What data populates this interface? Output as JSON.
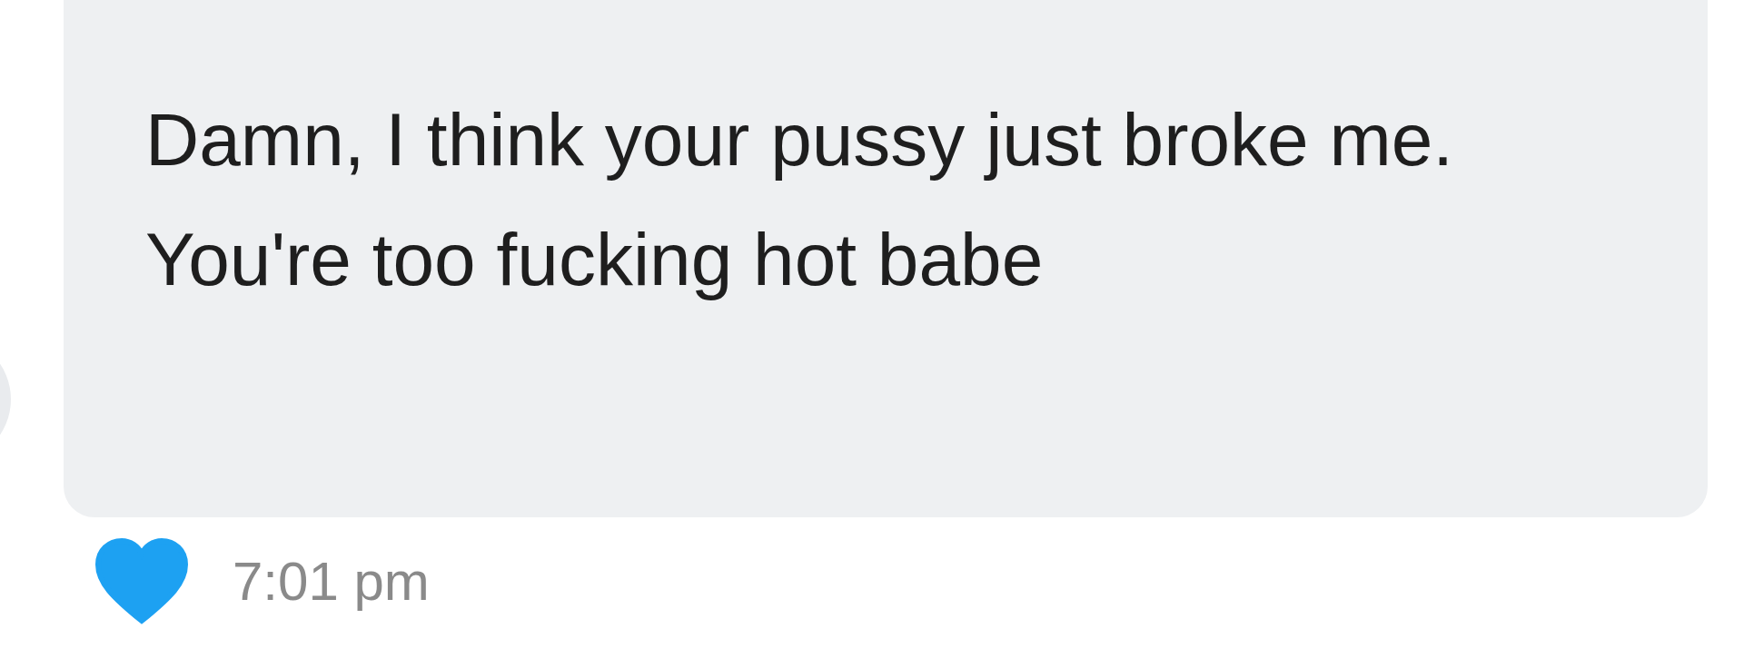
{
  "message": {
    "text": "Damn, I think your pussy just broke me. You're too fucking hot babe",
    "liked": true,
    "time": "7:01 pm"
  }
}
